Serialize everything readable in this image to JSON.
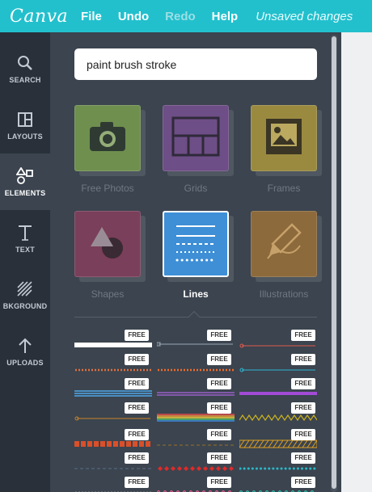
{
  "app": {
    "logo": "Canva",
    "menu": {
      "file": "File",
      "undo": "Undo",
      "redo": "Redo",
      "help": "Help"
    },
    "status": "Unsaved changes",
    "brand_color": "#22c0cd"
  },
  "sidebar": {
    "items": [
      {
        "label": "SEARCH",
        "icon": "search-icon"
      },
      {
        "label": "LAYOUTS",
        "icon": "layouts-icon"
      },
      {
        "label": "ELEMENTS",
        "icon": "elements-icon",
        "active": true
      },
      {
        "label": "TEXT",
        "icon": "text-icon"
      },
      {
        "label": "BKGROUND",
        "icon": "background-icon"
      },
      {
        "label": "UPLOADS",
        "icon": "uploads-icon"
      }
    ]
  },
  "search": {
    "value": "paint brush stroke"
  },
  "categories": [
    {
      "label": "Free Photos",
      "icon": "camera-icon",
      "color": "#6e8f4e"
    },
    {
      "label": "Grids",
      "icon": "grid-icon",
      "color": "#6e4e86"
    },
    {
      "label": "Frames",
      "icon": "frame-icon",
      "color": "#9a8a40"
    },
    {
      "label": "Shapes",
      "icon": "shapes-icon",
      "color": "#7a3f5a"
    },
    {
      "label": "Lines",
      "icon": "lines-icon",
      "color": "#3e8fd6",
      "active": true
    },
    {
      "label": "Illustrations",
      "icon": "pencil-icon",
      "color": "#8c6a3c"
    }
  ],
  "lines": {
    "badge": "FREE",
    "styles": [
      {
        "style": "thick-white",
        "color": "#ffffff"
      },
      {
        "style": "node-line",
        "color": "#9aa6b4"
      },
      {
        "style": "circle-line",
        "color": "#e05d4e"
      },
      {
        "style": "dotted",
        "color": "#e0703e"
      },
      {
        "style": "dotted",
        "color": "#f26b2a"
      },
      {
        "style": "circle-line",
        "color": "#2fb6d0"
      },
      {
        "style": "triple",
        "color": "#4fa6e8"
      },
      {
        "style": "double",
        "color": "#9a5ec8"
      },
      {
        "style": "thick",
        "color": "#a24bd6"
      },
      {
        "style": "circle-line",
        "color": "#c8832a"
      },
      {
        "style": "rainbow",
        "color": "#e24c4c"
      },
      {
        "style": "zigzag",
        "color": "#c8b020"
      },
      {
        "style": "blocks",
        "color": "#d9502a"
      },
      {
        "style": "dashed",
        "color": "#6a5a3a"
      },
      {
        "style": "hatched",
        "color": "#e0a020"
      },
      {
        "style": "dashed",
        "color": "#4a5a6a"
      },
      {
        "style": "diamonds",
        "color": "#e02a2a"
      },
      {
        "style": "dots",
        "color": "#2ab8c8"
      },
      {
        "style": "dotted",
        "color": "#c8c8c8"
      },
      {
        "style": "waves",
        "color": "#e05a8a"
      },
      {
        "style": "waves",
        "color": "#2ab8a8"
      }
    ]
  }
}
